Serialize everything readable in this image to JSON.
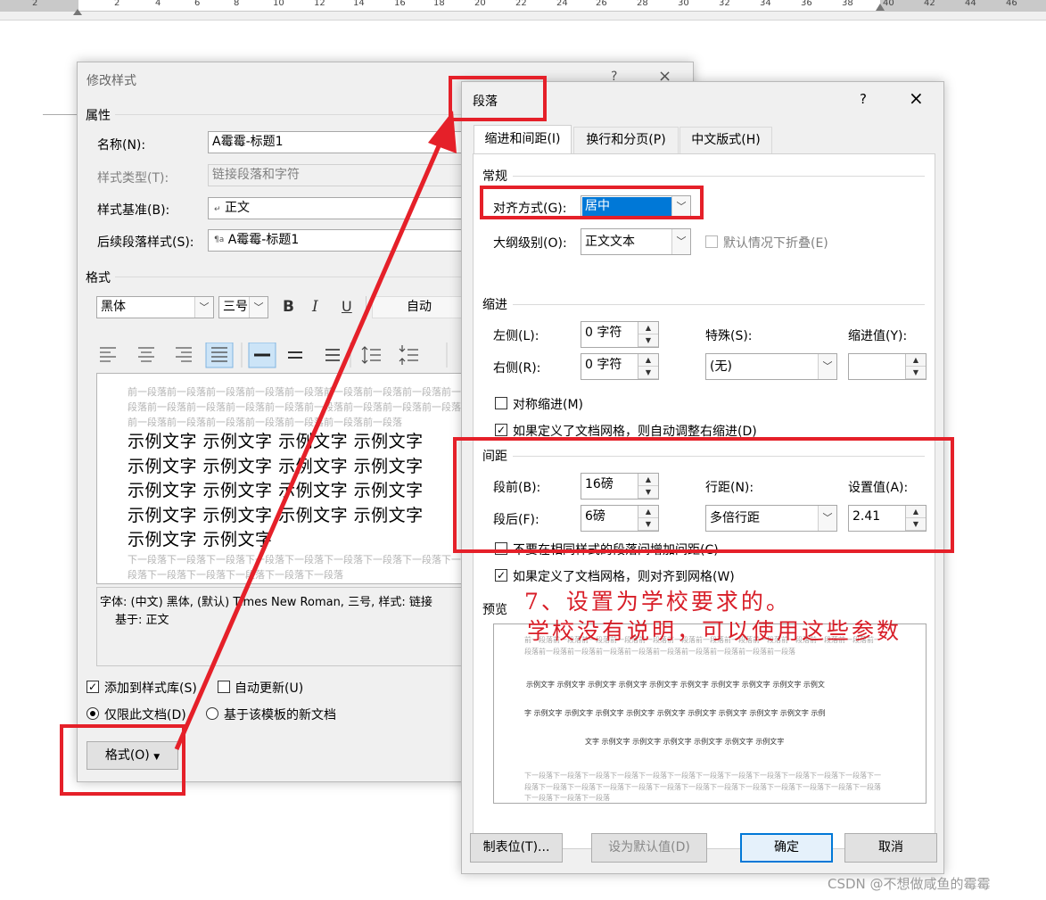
{
  "ruler": {
    "numbers": [
      "2",
      "",
      "2",
      "4",
      "6",
      "8",
      "10",
      "12",
      "14",
      "16",
      "18",
      "20",
      "22",
      "24",
      "26",
      "28",
      "30",
      "32",
      "34",
      "36",
      "38",
      "40",
      "42",
      "44",
      "46"
    ]
  },
  "modify_style": {
    "title": "修改样式",
    "help": "?",
    "close": "×",
    "properties_label": "属性",
    "name_label": "名称(N):",
    "name_value": "A霉霉-标题1",
    "style_type_label": "样式类型(T):",
    "style_type_value": "链接段落和字符",
    "based_on_label": "样式基准(B):",
    "based_on_value": "正文",
    "next_style_label": "后续段落样式(S):",
    "next_style_value": "A霉霉-标题1",
    "format_label": "格式",
    "font_value": "黑体",
    "size_value": "三号",
    "bold": "B",
    "italic": "I",
    "underline": "U",
    "color_value": "自动",
    "preview_prev": "前一段落前一段落前一段落前一段落前一段落前一段落前一段落前一段落前一段落前一段落前一段落前一段落前一段落前一段落前一段落前一段落前一段落前一段落前一段落前一段落前一段落前一段落前一段落前一段落",
    "preview_lines": [
      "示例文字 示例文字 示例文字 示例文字",
      "示例文字 示例文字 示例文字 示例文字",
      "示例文字 示例文字 示例文字 示例文字",
      "示例文字 示例文字 示例文字 示例文字",
      "示例文字 示例文字"
    ],
    "preview_next": "下一段落下一段落下一段落下一段落下一段落下一段落下一段落下一段落下一段落下一段落下一段落下一段落下一段落下一段落",
    "description_line1": "字体: (中文) 黑体, (默认) Times New Roman, 三号, 样式: 链接",
    "description_line2": "基于: 正文",
    "add_to_gallery": "添加到样式库(S)",
    "auto_update": "自动更新(U)",
    "only_this_doc": "仅限此文档(D)",
    "new_docs_template": "基于该模板的新文档",
    "format_button": "格式(O)"
  },
  "paragraph": {
    "title": "段落",
    "help": "?",
    "close": "×",
    "tabs": [
      "缩进和间距(I)",
      "换行和分页(P)",
      "中文版式(H)"
    ],
    "general_label": "常规",
    "alignment_label": "对齐方式(G):",
    "alignment_value": "居中",
    "outline_label": "大纲级别(O):",
    "outline_value": "正文文本",
    "collapsed_default": "默认情况下折叠(E)",
    "indent_label": "缩进",
    "left_label": "左侧(L):",
    "left_value": "0 字符",
    "right_label": "右侧(R):",
    "right_value": "0 字符",
    "special_label": "特殊(S):",
    "special_value": "(无)",
    "indent_by_label": "缩进值(Y):",
    "indent_by_value": "",
    "mirror_indents": "对称缩进(M)",
    "auto_adjust_indent": "如果定义了文档网格，则自动调整右缩进(D)",
    "spacing_label": "间距",
    "before_label": "段前(B):",
    "before_value": "16磅",
    "after_label": "段后(F):",
    "after_value": "6磅",
    "line_spacing_label": "行距(N):",
    "line_spacing_value": "多倍行距",
    "at_label": "设置值(A):",
    "at_value": "2.41",
    "no_space_same_style": "不要在相同样式的段落间增加间距(C)",
    "snap_to_grid": "如果定义了文档网格，则对齐到网格(W)",
    "preview_label": "预览",
    "preview_prev": "前一段落前一段落前一段落前一段落前一段落前一段落前一段落前一段落前一段落前一段落前一段落前一段落前一段落前一段落前一段落前一段落前一段落前一段落前一段落前一段落前一段落前一段落",
    "preview_lines": [
      "示例文字 示例文字 示例文字 示例文字 示例文字 示例文字 示例文字 示例文字 示例文字 示例文",
      "字 示例文字 示例文字 示例文字 示例文字 示例文字 示例文字 示例文字 示例文字 示例文字 示例",
      "文字 示例文字 示例文字 示例文字 示例文字 示例文字 示例文字"
    ],
    "preview_next": "下一段落下一段落下一段落下一段落下一段落下一段落下一段落下一段落下一段落下一段落下一段落下一段落下一段落下一段落下一段落下一段落下一段落下一段落下一段落下一段落下一段落下一段落下一段落下一段落下一段落下一段落下一段落下一段落",
    "tabs_button": "制表位(T)...",
    "set_default_button": "设为默认值(D)",
    "ok_button": "确定",
    "cancel_button": "取消"
  },
  "annotation": {
    "line1": "7、设置为学校要求的。",
    "line2": "学校没有说明，可以使用这些参数"
  },
  "watermark": "CSDN @不想做咸鱼的霉霉",
  "colors": {
    "annotation_red": "#e52029",
    "selection_blue": "#0078d7",
    "dialog_bg": "#f0f0f0"
  }
}
